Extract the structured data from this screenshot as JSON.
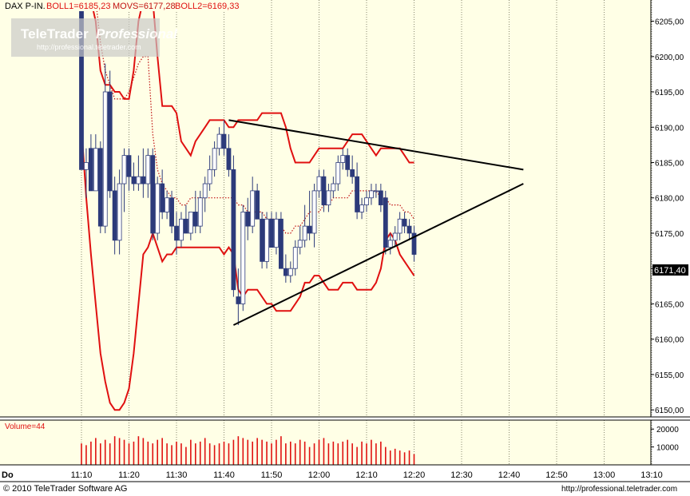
{
  "header": {
    "instrument": "DAX P-IN.",
    "boll1": "BOLL1=6185,23",
    "movs": "MOVS=6177,28",
    "boll2": "BOLL2=6169,33"
  },
  "watermark": {
    "brand": "TeleTrader",
    "product": "Professional",
    "url": "http://professional.teletrader.com"
  },
  "last_price_label": "6171,40",
  "volume_label": "Volume=44",
  "footer": {
    "copyright": "© 2010 TeleTrader Software AG",
    "url": "http://professional.teletrader.com"
  },
  "day_label": "Do",
  "colors": {
    "background": "#ffffe6",
    "bullish": "#ffffff",
    "bearish": "#2c3a7a",
    "bollinger": "#e01010",
    "moving_average": "#c01010",
    "trendline": "#000000"
  },
  "chart_data": {
    "type": "candlestick",
    "x_tick_labels": [
      "11:10",
      "11:20",
      "11:30",
      "11:40",
      "11:50",
      "12:00",
      "12:10",
      "12:20",
      "12:30",
      "12:40",
      "12:50",
      "13:00",
      "13:10"
    ],
    "y_tick_labels": [
      "6150,00",
      "6155,00",
      "6160,00",
      "6165,00",
      "6170,00",
      "6175,00",
      "6180,00",
      "6185,00",
      "6190,00",
      "6195,00",
      "6200,00",
      "6205,00"
    ],
    "ylim": [
      6149,
      6208
    ],
    "xlim_minutes": [
      0,
      125
    ],
    "candles": [
      {
        "t": 0,
        "o": 6225,
        "h": 6228,
        "l": 6184,
        "c": 6184
      },
      {
        "t": 1,
        "o": 6184,
        "h": 6187,
        "l": 6180,
        "c": 6185
      },
      {
        "t": 2,
        "o": 6187,
        "h": 6189,
        "l": 6181,
        "c": 6181
      },
      {
        "t": 3,
        "o": 6181,
        "h": 6189,
        "l": 6181,
        "c": 6187
      },
      {
        "t": 4,
        "o": 6187,
        "h": 6188,
        "l": 6175,
        "c": 6176
      },
      {
        "t": 5,
        "o": 6176,
        "h": 6199,
        "l": 6175,
        "c": 6195
      },
      {
        "t": 6,
        "o": 6195,
        "h": 6198,
        "l": 6180,
        "c": 6181
      },
      {
        "t": 7,
        "o": 6181,
        "h": 6183,
        "l": 6172,
        "c": 6174
      },
      {
        "t": 8,
        "o": 6174,
        "h": 6184,
        "l": 6172,
        "c": 6182
      },
      {
        "t": 9,
        "o": 6182,
        "h": 6187,
        "l": 6178,
        "c": 6186
      },
      {
        "t": 10,
        "o": 6186,
        "h": 6187,
        "l": 6181,
        "c": 6183
      },
      {
        "t": 11,
        "o": 6183,
        "h": 6185,
        "l": 6181,
        "c": 6182
      },
      {
        "t": 12,
        "o": 6182,
        "h": 6186,
        "l": 6181,
        "c": 6183
      },
      {
        "t": 13,
        "o": 6183,
        "h": 6187,
        "l": 6180,
        "c": 6182
      },
      {
        "t": 14,
        "o": 6182,
        "h": 6187,
        "l": 6180,
        "c": 6186
      },
      {
        "t": 15,
        "o": 6186,
        "h": 6187,
        "l": 6174,
        "c": 6175
      },
      {
        "t": 16,
        "o": 6175,
        "h": 6183,
        "l": 6174,
        "c": 6182
      },
      {
        "t": 17,
        "o": 6182,
        "h": 6184,
        "l": 6177,
        "c": 6178
      },
      {
        "t": 18,
        "o": 6178,
        "h": 6181,
        "l": 6177,
        "c": 6180
      },
      {
        "t": 19,
        "o": 6180,
        "h": 6181,
        "l": 6175,
        "c": 6176
      },
      {
        "t": 20,
        "o": 6176,
        "h": 6178,
        "l": 6172,
        "c": 6174
      },
      {
        "t": 21,
        "o": 6174,
        "h": 6178,
        "l": 6173,
        "c": 6177
      },
      {
        "t": 22,
        "o": 6177,
        "h": 6179,
        "l": 6175,
        "c": 6175
      },
      {
        "t": 23,
        "o": 6175,
        "h": 6178,
        "l": 6174,
        "c": 6178
      },
      {
        "t": 24,
        "o": 6178,
        "h": 6181,
        "l": 6175,
        "c": 6176
      },
      {
        "t": 25,
        "o": 6176,
        "h": 6181,
        "l": 6175,
        "c": 6180
      },
      {
        "t": 26,
        "o": 6180,
        "h": 6183,
        "l": 6178,
        "c": 6182
      },
      {
        "t": 27,
        "o": 6182,
        "h": 6186,
        "l": 6181,
        "c": 6184
      },
      {
        "t": 28,
        "o": 6184,
        "h": 6188,
        "l": 6183,
        "c": 6187
      },
      {
        "t": 29,
        "o": 6187,
        "h": 6190,
        "l": 6186,
        "c": 6189
      },
      {
        "t": 30,
        "o": 6189,
        "h": 6191,
        "l": 6186,
        "c": 6187
      },
      {
        "t": 31,
        "o": 6187,
        "h": 6189,
        "l": 6183,
        "c": 6184
      },
      {
        "t": 32,
        "o": 6184,
        "h": 6186,
        "l": 6166,
        "c": 6167
      },
      {
        "t": 33,
        "o": 6166,
        "h": 6170,
        "l": 6162,
        "c": 6165
      },
      {
        "t": 34,
        "o": 6165,
        "h": 6179,
        "l": 6164,
        "c": 6178
      },
      {
        "t": 35,
        "o": 6178,
        "h": 6180,
        "l": 6174,
        "c": 6176
      },
      {
        "t": 36,
        "o": 6176,
        "h": 6183,
        "l": 6175,
        "c": 6181
      },
      {
        "t": 37,
        "o": 6181,
        "h": 6182,
        "l": 6177,
        "c": 6177
      },
      {
        "t": 38,
        "o": 6177,
        "h": 6178,
        "l": 6170,
        "c": 6171
      },
      {
        "t": 39,
        "o": 6171,
        "h": 6178,
        "l": 6170,
        "c": 6177
      },
      {
        "t": 40,
        "o": 6177,
        "h": 6178,
        "l": 6173,
        "c": 6173
      },
      {
        "t": 41,
        "o": 6173,
        "h": 6178,
        "l": 6172,
        "c": 6177
      },
      {
        "t": 42,
        "o": 6177,
        "h": 6178,
        "l": 6170,
        "c": 6170
      },
      {
        "t": 43,
        "o": 6170,
        "h": 6172,
        "l": 6168,
        "c": 6169
      },
      {
        "t": 44,
        "o": 6169,
        "h": 6171,
        "l": 6168,
        "c": 6170
      },
      {
        "t": 45,
        "o": 6170,
        "h": 6174,
        "l": 6169,
        "c": 6173
      },
      {
        "t": 46,
        "o": 6173,
        "h": 6176,
        "l": 6172,
        "c": 6174
      },
      {
        "t": 47,
        "o": 6174,
        "h": 6179,
        "l": 6173,
        "c": 6176
      },
      {
        "t": 48,
        "o": 6176,
        "h": 6181,
        "l": 6174,
        "c": 6175
      },
      {
        "t": 49,
        "o": 6175,
        "h": 6182,
        "l": 6173,
        "c": 6181
      },
      {
        "t": 50,
        "o": 6181,
        "h": 6184,
        "l": 6180,
        "c": 6183
      },
      {
        "t": 51,
        "o": 6183,
        "h": 6184,
        "l": 6178,
        "c": 6179
      },
      {
        "t": 52,
        "o": 6179,
        "h": 6182,
        "l": 6178,
        "c": 6181
      },
      {
        "t": 53,
        "o": 6181,
        "h": 6183,
        "l": 6180,
        "c": 6182
      },
      {
        "t": 54,
        "o": 6182,
        "h": 6186,
        "l": 6181,
        "c": 6185
      },
      {
        "t": 55,
        "o": 6185,
        "h": 6187,
        "l": 6184,
        "c": 6186
      },
      {
        "t": 56,
        "o": 6186,
        "h": 6187,
        "l": 6183,
        "c": 6184
      },
      {
        "t": 57,
        "o": 6184,
        "h": 6186,
        "l": 6182,
        "c": 6183
      },
      {
        "t": 58,
        "o": 6183,
        "h": 6185,
        "l": 6177,
        "c": 6178
      },
      {
        "t": 59,
        "o": 6178,
        "h": 6180,
        "l": 6177,
        "c": 6179
      },
      {
        "t": 60,
        "o": 6179,
        "h": 6181,
        "l": 6178,
        "c": 6180
      },
      {
        "t": 61,
        "o": 6180,
        "h": 6182,
        "l": 6179,
        "c": 6181
      },
      {
        "t": 62,
        "o": 6181,
        "h": 6182,
        "l": 6180,
        "c": 6181
      },
      {
        "t": 63,
        "o": 6181,
        "h": 6182,
        "l": 6178,
        "c": 6179
      },
      {
        "t": 64,
        "o": 6180,
        "h": 6181,
        "l": 6172,
        "c": 6173
      },
      {
        "t": 65,
        "o": 6173,
        "h": 6175,
        "l": 6172,
        "c": 6174
      },
      {
        "t": 66,
        "o": 6174,
        "h": 6176,
        "l": 6173,
        "c": 6175
      },
      {
        "t": 67,
        "o": 6175,
        "h": 6178,
        "l": 6174,
        "c": 6177
      },
      {
        "t": 68,
        "o": 6177,
        "h": 6178,
        "l": 6175,
        "c": 6176
      },
      {
        "t": 69,
        "o": 6176,
        "h": 6177,
        "l": 6174,
        "c": 6175
      },
      {
        "t": 70,
        "o": 6175,
        "h": 6176,
        "l": 6171,
        "c": 6172
      }
    ],
    "bollinger_upper": [
      [
        0,
        6260
      ],
      [
        1,
        6240
      ],
      [
        2,
        6222
      ],
      [
        3,
        6205
      ],
      [
        4,
        6198
      ],
      [
        5,
        6196
      ],
      [
        6,
        6196
      ],
      [
        7,
        6195
      ],
      [
        8,
        6195
      ],
      [
        9,
        6194
      ],
      [
        10,
        6194
      ],
      [
        11,
        6198
      ],
      [
        12,
        6205
      ],
      [
        13,
        6220
      ],
      [
        14,
        6232
      ],
      [
        15,
        6228
      ],
      [
        16,
        6200
      ],
      [
        17,
        6193
      ],
      [
        18,
        6193
      ],
      [
        19,
        6193
      ],
      [
        20,
        6192
      ],
      [
        21,
        6188
      ],
      [
        22,
        6187
      ],
      [
        23,
        6186
      ],
      [
        24,
        6188
      ],
      [
        25,
        6189
      ],
      [
        26,
        6190
      ],
      [
        27,
        6191
      ],
      [
        28,
        6191
      ],
      [
        29,
        6191
      ],
      [
        30,
        6191
      ],
      [
        31,
        6190
      ],
      [
        32,
        6190
      ],
      [
        33,
        6191
      ],
      [
        34,
        6191
      ],
      [
        35,
        6191
      ],
      [
        36,
        6191
      ],
      [
        37,
        6191
      ],
      [
        38,
        6192
      ],
      [
        39,
        6192
      ],
      [
        40,
        6192
      ],
      [
        41,
        6192
      ],
      [
        42,
        6192
      ],
      [
        43,
        6190
      ],
      [
        44,
        6187
      ],
      [
        45,
        6185
      ],
      [
        46,
        6185
      ],
      [
        47,
        6185
      ],
      [
        48,
        6185
      ],
      [
        49,
        6186
      ],
      [
        50,
        6187
      ],
      [
        51,
        6187
      ],
      [
        52,
        6187
      ],
      [
        53,
        6187
      ],
      [
        54,
        6187
      ],
      [
        55,
        6187
      ],
      [
        56,
        6188
      ],
      [
        57,
        6189
      ],
      [
        58,
        6189
      ],
      [
        59,
        6189
      ],
      [
        60,
        6188
      ],
      [
        61,
        6187
      ],
      [
        62,
        6186
      ],
      [
        63,
        6187
      ],
      [
        64,
        6187
      ],
      [
        65,
        6187
      ],
      [
        66,
        6187
      ],
      [
        67,
        6187
      ],
      [
        68,
        6186
      ],
      [
        69,
        6185
      ],
      [
        70,
        6185
      ]
    ],
    "moving_average": [
      [
        0,
        6225
      ],
      [
        1,
        6222
      ],
      [
        2,
        6215
      ],
      [
        3,
        6208
      ],
      [
        4,
        6202
      ],
      [
        5,
        6198
      ],
      [
        6,
        6196
      ],
      [
        7,
        6194
      ],
      [
        8,
        6194
      ],
      [
        9,
        6194
      ],
      [
        10,
        6195
      ],
      [
        11,
        6197
      ],
      [
        12,
        6199
      ],
      [
        13,
        6200
      ],
      [
        14,
        6200
      ],
      [
        15,
        6189
      ],
      [
        16,
        6184
      ],
      [
        17,
        6182
      ],
      [
        18,
        6181
      ],
      [
        19,
        6180
      ],
      [
        20,
        6180
      ],
      [
        21,
        6179
      ],
      [
        22,
        6179
      ],
      [
        23,
        6180
      ],
      [
        24,
        6180
      ],
      [
        25,
        6180
      ],
      [
        26,
        6180
      ],
      [
        27,
        6180
      ],
      [
        28,
        6180
      ],
      [
        29,
        6180
      ],
      [
        30,
        6180
      ],
      [
        31,
        6180
      ],
      [
        32,
        6180
      ],
      [
        33,
        6179
      ],
      [
        34,
        6179
      ],
      [
        35,
        6178
      ],
      [
        36,
        6178
      ],
      [
        37,
        6178
      ],
      [
        38,
        6178
      ],
      [
        39,
        6177
      ],
      [
        40,
        6177
      ],
      [
        41,
        6177
      ],
      [
        42,
        6176
      ],
      [
        43,
        6175
      ],
      [
        44,
        6175
      ],
      [
        45,
        6176
      ],
      [
        46,
        6176
      ],
      [
        47,
        6177
      ],
      [
        48,
        6178
      ],
      [
        49,
        6178
      ],
      [
        50,
        6178
      ],
      [
        51,
        6179
      ],
      [
        52,
        6179
      ],
      [
        53,
        6180
      ],
      [
        54,
        6180
      ],
      [
        55,
        6180
      ],
      [
        56,
        6180
      ],
      [
        57,
        6181
      ],
      [
        58,
        6181
      ],
      [
        59,
        6181
      ],
      [
        60,
        6181
      ],
      [
        61,
        6181
      ],
      [
        62,
        6181
      ],
      [
        63,
        6180
      ],
      [
        64,
        6180
      ],
      [
        65,
        6179
      ],
      [
        66,
        6179
      ],
      [
        67,
        6179
      ],
      [
        68,
        6178
      ],
      [
        69,
        6178
      ],
      [
        70,
        6177
      ]
    ],
    "bollinger_lower": [
      [
        0,
        6190
      ],
      [
        1,
        6180
      ],
      [
        2,
        6172
      ],
      [
        3,
        6165
      ],
      [
        4,
        6158
      ],
      [
        5,
        6154
      ],
      [
        6,
        6151
      ],
      [
        7,
        6150
      ],
      [
        8,
        6150
      ],
      [
        9,
        6151
      ],
      [
        10,
        6153
      ],
      [
        11,
        6158
      ],
      [
        12,
        6165
      ],
      [
        13,
        6172
      ],
      [
        14,
        6173
      ],
      [
        15,
        6175
      ],
      [
        16,
        6173
      ],
      [
        17,
        6171
      ],
      [
        18,
        6172
      ],
      [
        19,
        6172
      ],
      [
        20,
        6173
      ],
      [
        21,
        6173
      ],
      [
        22,
        6173
      ],
      [
        23,
        6173
      ],
      [
        24,
        6173
      ],
      [
        25,
        6173
      ],
      [
        26,
        6173
      ],
      [
        27,
        6173
      ],
      [
        28,
        6173
      ],
      [
        29,
        6173
      ],
      [
        30,
        6172
      ],
      [
        31,
        6173
      ],
      [
        32,
        6172
      ],
      [
        33,
        6167
      ],
      [
        34,
        6166
      ],
      [
        35,
        6167
      ],
      [
        36,
        6167
      ],
      [
        37,
        6167
      ],
      [
        38,
        6166
      ],
      [
        39,
        6165
      ],
      [
        40,
        6165
      ],
      [
        41,
        6164
      ],
      [
        42,
        6164
      ],
      [
        43,
        6164
      ],
      [
        44,
        6164
      ],
      [
        45,
        6165
      ],
      [
        46,
        6166
      ],
      [
        47,
        6168
      ],
      [
        48,
        6168
      ],
      [
        49,
        6169
      ],
      [
        50,
        6169
      ],
      [
        51,
        6168
      ],
      [
        52,
        6167
      ],
      [
        53,
        6167
      ],
      [
        54,
        6167
      ],
      [
        55,
        6168
      ],
      [
        56,
        6168
      ],
      [
        57,
        6168
      ],
      [
        58,
        6167
      ],
      [
        59,
        6167
      ],
      [
        60,
        6167
      ],
      [
        61,
        6167
      ],
      [
        62,
        6168
      ],
      [
        63,
        6170
      ],
      [
        64,
        6174
      ],
      [
        65,
        6175
      ],
      [
        66,
        6174
      ],
      [
        67,
        6172
      ],
      [
        68,
        6171
      ],
      [
        69,
        6170
      ],
      [
        70,
        6169
      ]
    ],
    "trendline_upper": [
      [
        31,
        6191
      ],
      [
        93,
        6184
      ]
    ],
    "trendline_lower": [
      [
        32,
        6162
      ],
      [
        93,
        6182
      ]
    ],
    "volume": {
      "ymax": 25000,
      "y_tick_labels": [
        "10000",
        "20000"
      ],
      "y_tick_values": [
        10000,
        20000
      ],
      "bars": [
        12000,
        11000,
        13000,
        15000,
        12000,
        14000,
        12000,
        16000,
        15000,
        14000,
        12000,
        13000,
        16000,
        15000,
        13000,
        12000,
        14000,
        15000,
        12000,
        11000,
        13000,
        12000,
        10000,
        14000,
        12000,
        13000,
        15000,
        12000,
        11000,
        12000,
        13000,
        12000,
        14000,
        16000,
        15000,
        14000,
        13000,
        15000,
        14000,
        13000,
        12000,
        14000,
        16000,
        12000,
        13000,
        12000,
        14000,
        13000,
        10000,
        12000,
        14000,
        15000,
        12000,
        13000,
        12000,
        13000,
        14000,
        12000,
        10000,
        13000,
        12000,
        14000,
        12000,
        13000,
        10000,
        8000,
        9000,
        8000,
        7000,
        8000,
        6000
      ]
    }
  }
}
